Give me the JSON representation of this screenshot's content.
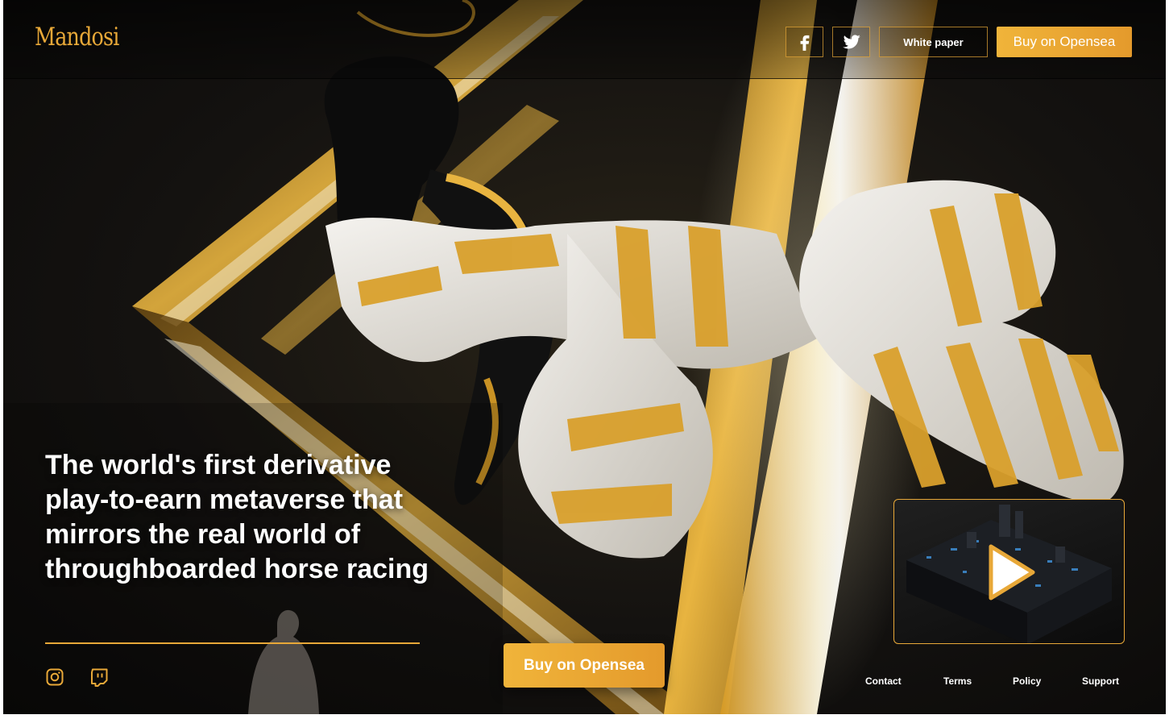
{
  "brand": {
    "logo": "Mandosi"
  },
  "header": {
    "social": [
      {
        "icon": "facebook-icon"
      },
      {
        "icon": "twitter-icon"
      }
    ],
    "white_paper_label": "White paper",
    "buy_label": "Buy on Opensea"
  },
  "hero": {
    "headline": "The world's first derivative play-to-earn metaverse that mirrors the real world of throughboarded horse racing",
    "buy_label": "Buy on Opensea"
  },
  "social_footer": [
    {
      "icon": "instagram-icon"
    },
    {
      "icon": "twitch-icon"
    }
  ],
  "video": {
    "icon": "play-icon"
  },
  "footer": {
    "links": [
      "Contact",
      "Terms",
      "Policy",
      "Support"
    ]
  },
  "colors": {
    "accent": "#e8a838",
    "accent_gradient_start": "#f0b43a",
    "accent_gradient_end": "#e49a2c",
    "text": "#ffffff",
    "background": "#141210"
  }
}
